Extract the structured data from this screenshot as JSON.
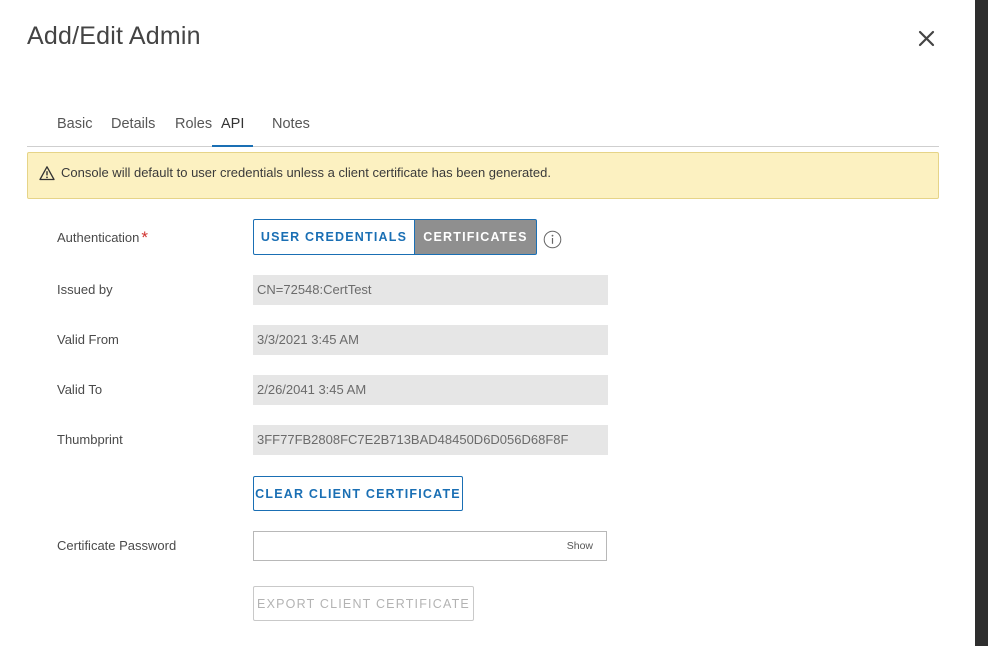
{
  "dialog": {
    "title": "Add/Edit Admin",
    "close_icon": "close-icon"
  },
  "tabs": [
    {
      "label": "Basic",
      "active": false
    },
    {
      "label": "Details",
      "active": false
    },
    {
      "label": "Roles",
      "active": false
    },
    {
      "label": "API",
      "active": true
    },
    {
      "label": "Notes",
      "active": false
    }
  ],
  "banner": {
    "icon": "warning-icon",
    "message": "Console will default to user credentials unless a client certificate has been generated."
  },
  "form": {
    "authentication": {
      "label": "Authentication",
      "required_marker": "*",
      "options": [
        "USER CREDENTIALS",
        "CERTIFICATES"
      ],
      "selected": "CERTIFICATES",
      "info_icon": "info-icon"
    },
    "issued_by": {
      "label": "Issued by",
      "value": "CN=72548:CertTest"
    },
    "valid_from": {
      "label": "Valid From",
      "value": "3/3/2021 3:45 AM"
    },
    "valid_to": {
      "label": "Valid To",
      "value": "2/26/2041 3:45 AM"
    },
    "thumbprint": {
      "label": "Thumbprint",
      "value": "3FF77FB2808FC7E2B713BAD48450D6D056D68F8F"
    },
    "clear_button": "CLEAR CLIENT CERTIFICATE",
    "certificate_password": {
      "label": "Certificate Password",
      "value": "",
      "show_label": "Show"
    },
    "export_button": "EXPORT CLIENT CERTIFICATE"
  },
  "colors": {
    "accent": "#1a6fb4",
    "banner_bg": "#fcf1c1",
    "selected_segment_bg": "#8f8f8f",
    "required": "#d0312d"
  }
}
